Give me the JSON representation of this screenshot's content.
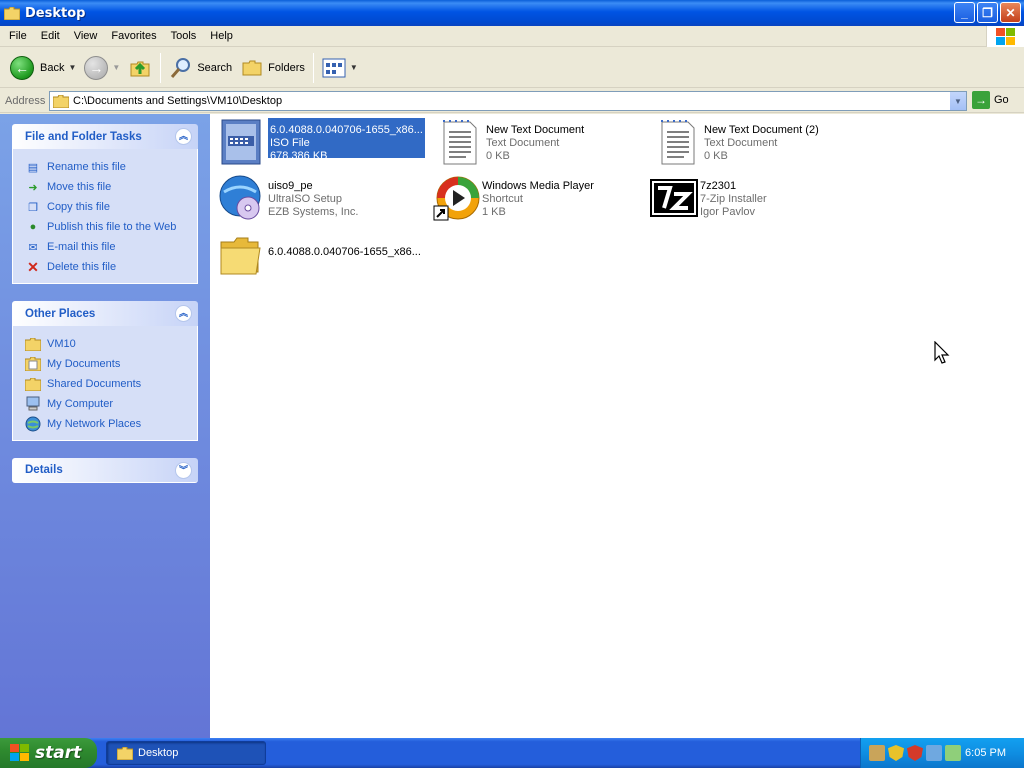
{
  "window": {
    "title": "Desktop"
  },
  "menu": [
    "File",
    "Edit",
    "View",
    "Favorites",
    "Tools",
    "Help"
  ],
  "toolbar": {
    "back": "Back",
    "search": "Search",
    "folders": "Folders"
  },
  "address": {
    "label": "Address",
    "path": "C:\\Documents and Settings\\VM10\\Desktop",
    "go": "Go"
  },
  "tasks_panel": {
    "title": "File and Folder Tasks",
    "items": [
      "Rename this file",
      "Move this file",
      "Copy this file",
      "Publish this file to the Web",
      "E-mail this file",
      "Delete this file"
    ]
  },
  "places_panel": {
    "title": "Other Places",
    "items": [
      "VM10",
      "My Documents",
      "Shared Documents",
      "My Computer",
      "My Network Places"
    ]
  },
  "details_panel": {
    "title": "Details"
  },
  "files": [
    {
      "name": "6.0.4088.0.040706-1655_x86...",
      "type": "ISO File",
      "info": "678,386 KB",
      "icon": "iso-file-icon",
      "selected": true
    },
    {
      "name": "New Text Document",
      "type": "Text Document",
      "info": "0 KB",
      "icon": "text-document-icon"
    },
    {
      "name": "New Text Document (2)",
      "type": "Text Document",
      "info": "0 KB",
      "icon": "text-document-icon"
    },
    {
      "name": "uiso9_pe",
      "type": "UltraISO Setup",
      "info": "EZB Systems, Inc.",
      "icon": "ultraiso-setup-icon"
    },
    {
      "name": "Windows Media Player",
      "type": "Shortcut",
      "info": "1 KB",
      "icon": "media-player-icon"
    },
    {
      "name": "7z2301",
      "type": "7-Zip Installer",
      "info": "Igor Pavlov",
      "icon": "7zip-icon"
    },
    {
      "name": "6.0.4088.0.040706-1655_x86...",
      "type": "",
      "info": "",
      "icon": "folder-icon"
    }
  ],
  "taskbar": {
    "start": "start",
    "task": "Desktop",
    "clock": "6:05 PM"
  }
}
